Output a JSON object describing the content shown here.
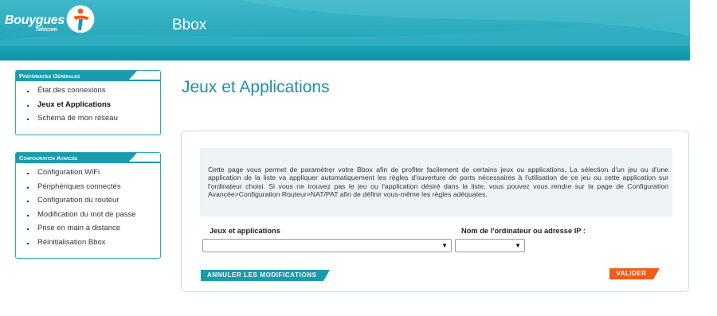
{
  "header": {
    "brand": "Bouygues",
    "brand_sub": "Telecom",
    "app_title": "Bbox",
    "accent": "#1a9cae"
  },
  "sidebar": {
    "sections": [
      {
        "title": "Préférences Générales",
        "items": [
          {
            "label": "État des connexions",
            "active": false
          },
          {
            "label": "Jeux et Applications",
            "active": true
          },
          {
            "label": "Schéma de mon réseau",
            "active": false
          }
        ]
      },
      {
        "title": "Configuration Avancée",
        "items": [
          {
            "label": "Configuration WiFi"
          },
          {
            "label": "Périphériques connectés"
          },
          {
            "label": "Configuration du routeur"
          },
          {
            "label": "Modification du mot de passe"
          },
          {
            "label": "Prise en main à distance"
          },
          {
            "label": "Réinitialisation Bbox"
          }
        ]
      }
    ]
  },
  "main": {
    "title": "Jeux et Applications",
    "info": "Cette page vous permet de paramétrer votre Bbox afin de profiter facilement de certains jeux ou applications. La sélection d'un jeu ou d'une application de la liste va appliquer automatiquement les règles d'ouverture de ports nécessaires à l'utilisation de ce jeu ou cette application sur l'ordinateur choisi. Si vous ne trouvez pas le jeu ou l'application désiré dans la liste, vous pouvez vous rendre sur la page de Configuration Avancée>Configuration Routeur>NAT/PAT afin de définir vous-même les règles adéquates.",
    "games_label": "Jeux et applications",
    "games_value": "",
    "ip_label": "Nom de l'ordinateur ou adresse IP :",
    "ip_value": "",
    "cancel_label": "ANNULER LES MODIFICATIONS",
    "ok_label": "VALIDER",
    "ok_color": "#f25c14"
  }
}
